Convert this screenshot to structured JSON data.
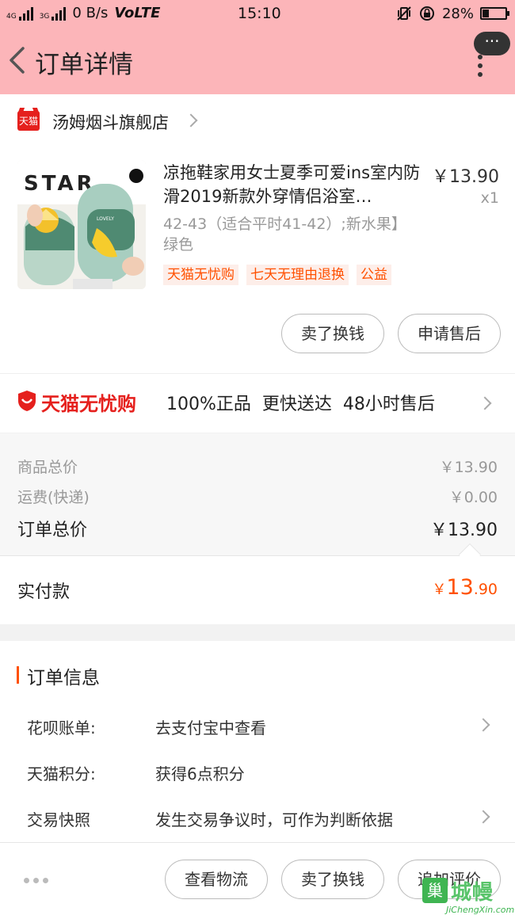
{
  "status_bar": {
    "network_top": "4G",
    "network_bottom": "3G",
    "speed": "0 B/s",
    "volte": "VoLTE",
    "time": "15:10",
    "battery": "28%",
    "battery_level": 0.28
  },
  "nav": {
    "title": "订单详情",
    "more_bubble": "···"
  },
  "shop": {
    "badge": "天猫",
    "name": "汤姆烟斗旗舰店"
  },
  "product": {
    "title": "凉拖鞋家用女士夏季可爱ins室内防滑2019新款外穿情侣浴室…",
    "price": "￥13.90",
    "qty": "x1",
    "spec": "42-43（适合平时41-42）;新水果】绿色",
    "image_text": "STAR",
    "image_brand": "LOVELY",
    "tags": [
      "天猫无忧购",
      "七天无理由退换",
      "公益"
    ]
  },
  "actions": {
    "sell": "卖了换钱",
    "after_sale": "申请售后"
  },
  "guarantee": {
    "brand": "天猫无忧购",
    "text": "100%正品  更快送达  48小时售后"
  },
  "prices": {
    "goods_label": "商品总价",
    "goods_value": "￥13.90",
    "shipping_label": "运费(快递)",
    "shipping_value": "￥0.00",
    "total_label": "订单总价",
    "total_value": "￥13.90",
    "paid_label": "实付款",
    "paid_currency": "￥",
    "paid_int": "13",
    "paid_dec": ".90"
  },
  "order_info": {
    "title": "订单信息",
    "rows": [
      {
        "key": "花呗账单:",
        "value": "去支付宝中查看"
      },
      {
        "key": "天猫积分:",
        "value": "获得6点积分"
      },
      {
        "key": "交易快照",
        "value": "发生交易争议时，可作为判断依据"
      }
    ]
  },
  "bottom_bar": {
    "logistics": "查看物流",
    "sell": "卖了换钱",
    "review": "追加评价"
  },
  "watermark": {
    "icon": "巢",
    "cn": "城幔",
    "en": "JiChengXin.com"
  },
  "colors": {
    "header": "#fcb5b9",
    "accent": "#ff5000",
    "tmall_red": "#e5201d"
  }
}
